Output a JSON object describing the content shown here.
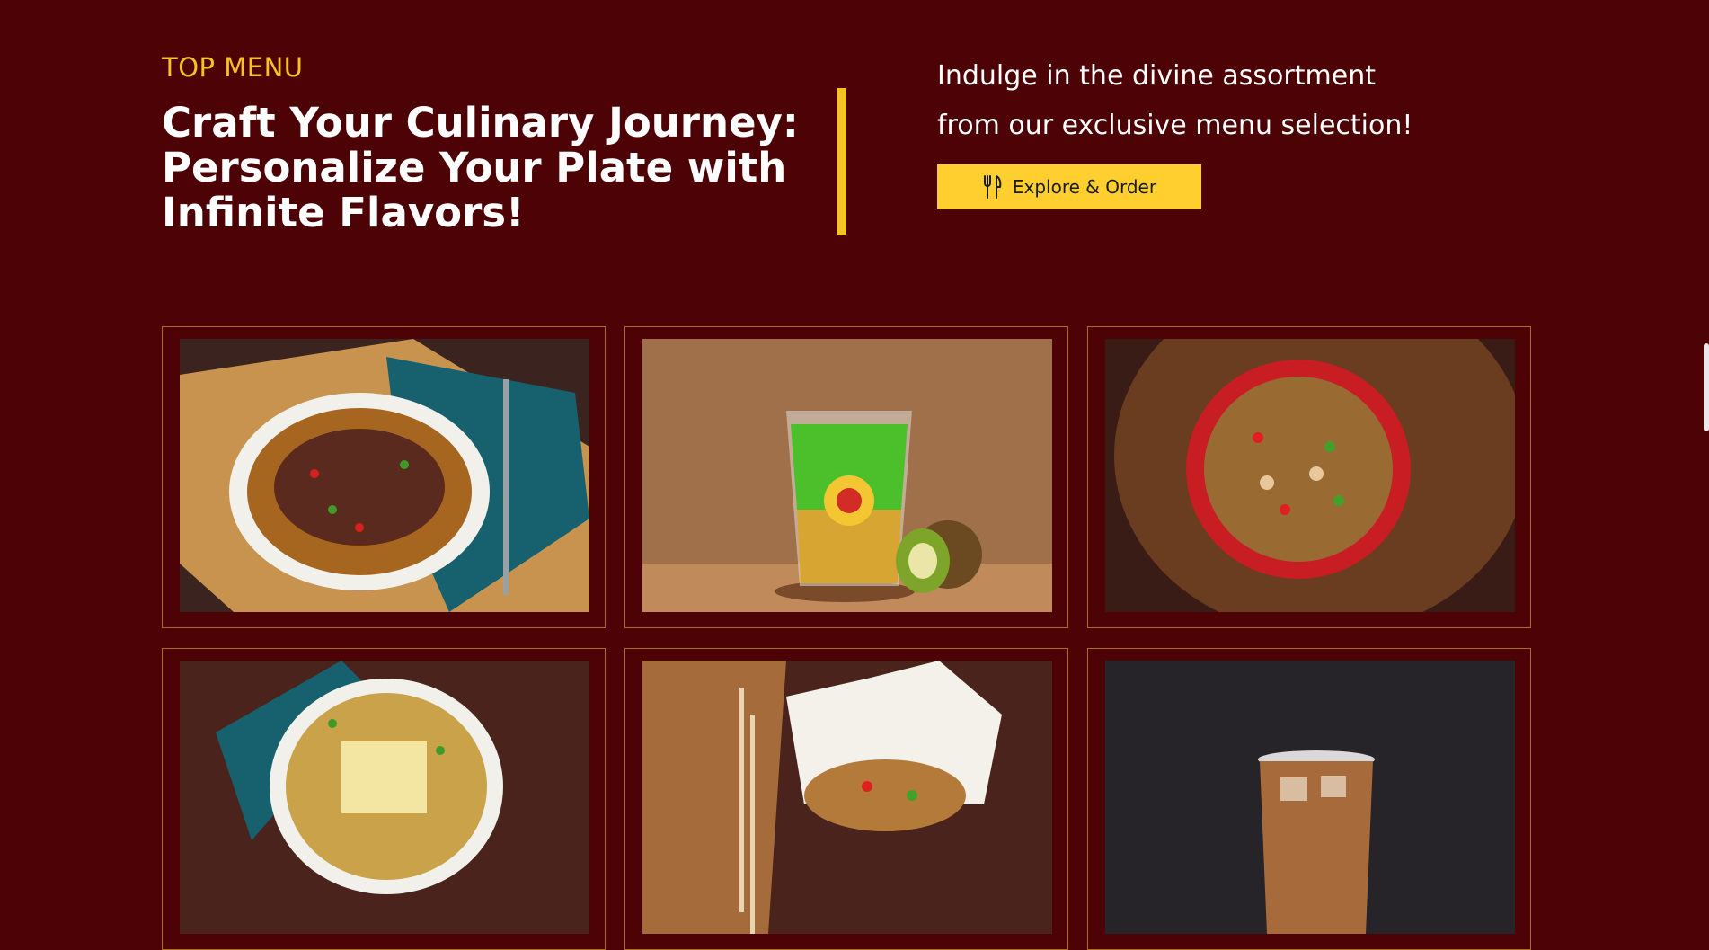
{
  "hero": {
    "eyebrow": "TOP MENU",
    "headline": "Craft Your Culinary Journey: Personalize Your Plate with Infinite Flavors!",
    "tagline": "Indulge in the divine assortment from our exclusive menu selection!",
    "cta_label": "Explore & Order",
    "cta_icon": "fork-knife-icon"
  },
  "colors": {
    "background": "#4d0305",
    "accent": "#f5c323",
    "button": "#fecf2f",
    "card_border": "#a7701c"
  }
}
